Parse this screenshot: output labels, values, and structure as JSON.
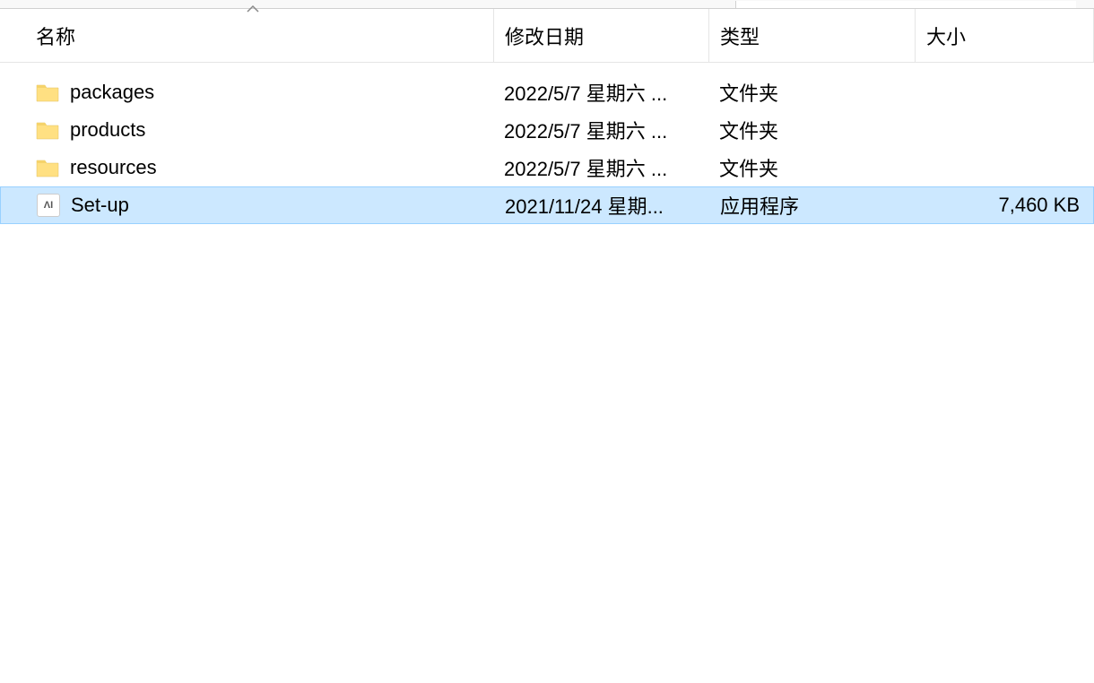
{
  "columns": {
    "name": "名称",
    "modified": "修改日期",
    "type": "类型",
    "size": "大小"
  },
  "sort_indicator": "ˆ",
  "items": [
    {
      "icon": "folder",
      "name": "packages",
      "modified": "2022/5/7 星期六 ...",
      "type": "文件夹",
      "size": "",
      "selected": false
    },
    {
      "icon": "folder",
      "name": "products",
      "modified": "2022/5/7 星期六 ...",
      "type": "文件夹",
      "size": "",
      "selected": false
    },
    {
      "icon": "folder",
      "name": "resources",
      "modified": "2022/5/7 星期六 ...",
      "type": "文件夹",
      "size": "",
      "selected": false
    },
    {
      "icon": "app",
      "name": "Set-up",
      "modified": "2021/11/24 星期...",
      "type": "应用程序",
      "size": "7,460 KB",
      "selected": true
    }
  ]
}
